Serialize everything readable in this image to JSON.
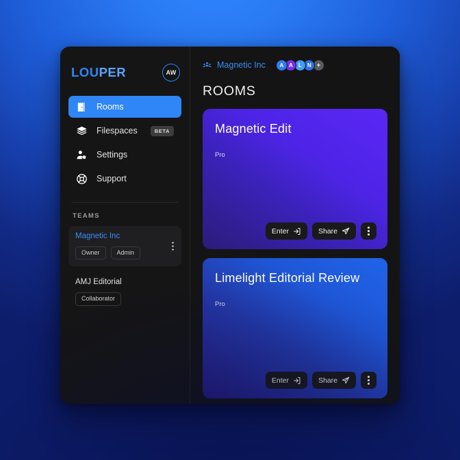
{
  "sidebar": {
    "brand": {
      "text_bold": "LOU",
      "text_light": "PER",
      "full": "LOUPER"
    },
    "user_avatar": {
      "initials": "AW",
      "ring_color": "#2f86f6"
    },
    "nav": [
      {
        "label": "Rooms",
        "icon": "door-icon",
        "active": true,
        "badge": ""
      },
      {
        "label": "Filespaces",
        "icon": "layers-icon",
        "active": false,
        "badge": "BETA"
      },
      {
        "label": "Settings",
        "icon": "user-gear-icon",
        "active": false,
        "badge": ""
      },
      {
        "label": "Support",
        "icon": "lifebuoy-icon",
        "active": false,
        "badge": ""
      }
    ],
    "teams_heading": "TEAMS",
    "teams": [
      {
        "name": "Magnetic Inc",
        "roles": [
          "Owner",
          "Admin"
        ],
        "selected": true
      },
      {
        "name": "AMJ Editorial",
        "roles": [
          "Collaborator"
        ],
        "selected": false
      }
    ]
  },
  "main": {
    "org": {
      "icon": "people-group-icon",
      "name": "Magnetic Inc",
      "color": "#3b8bf7"
    },
    "members": [
      {
        "initials": "A",
        "color": "#2f7def"
      },
      {
        "initials": "A",
        "color": "#7b2ff2"
      },
      {
        "initials": "L",
        "color": "#3f9ef5"
      },
      {
        "initials": "N",
        "color": "#2f6fe8"
      },
      {
        "initials": "+",
        "color": "#5a5a60"
      }
    ],
    "page_title": "ROOMS",
    "rooms": [
      {
        "title": "Magnetic Edit",
        "plan": "Pro",
        "gradient_from": "#2c1d7a",
        "gradient_to": "#5a27f5",
        "enter_label": "Enter",
        "share_label": "Share"
      },
      {
        "title": "Limelight Editorial Review",
        "plan": "Pro",
        "gradient_from": "#271d7e",
        "gradient_to": "#2063e8",
        "enter_label": "Enter",
        "share_label": "Share"
      }
    ]
  }
}
